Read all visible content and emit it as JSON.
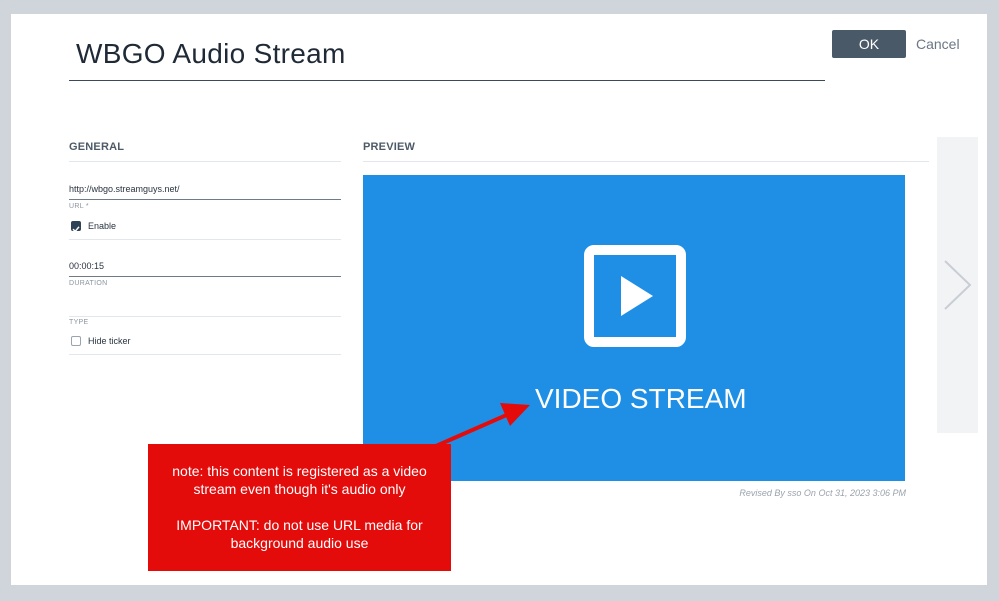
{
  "header": {
    "title": "WBGO Audio Stream",
    "ok_label": "OK",
    "cancel_label": "Cancel"
  },
  "general": {
    "heading": "GENERAL",
    "url_value": "http://wbgo.streamguys.net/",
    "url_label": "URL *",
    "enable_label": "Enable",
    "enable_checked": true,
    "duration_value": "00:00:15",
    "duration_label": "DURATION",
    "type_label": "TYPE",
    "hide_ticker_label": "Hide ticker",
    "hide_ticker_checked": false
  },
  "preview": {
    "heading": "PREVIEW",
    "caption": "VIDEO STREAM",
    "revised": "Revised By sso On Oct 31, 2023 3:06 PM"
  },
  "annotation": {
    "line1": "note: this content is registered as a video stream even though it's audio only",
    "line2": "IMPORTANT: do not use URL media for background audio use"
  },
  "colors": {
    "accent": "#1f8fe6",
    "note_red": "#e40b0b",
    "ok_button": "#4a5968"
  },
  "icons": {
    "play": "play-icon",
    "next": "chevron-right-icon",
    "check": "checkmark-icon"
  }
}
